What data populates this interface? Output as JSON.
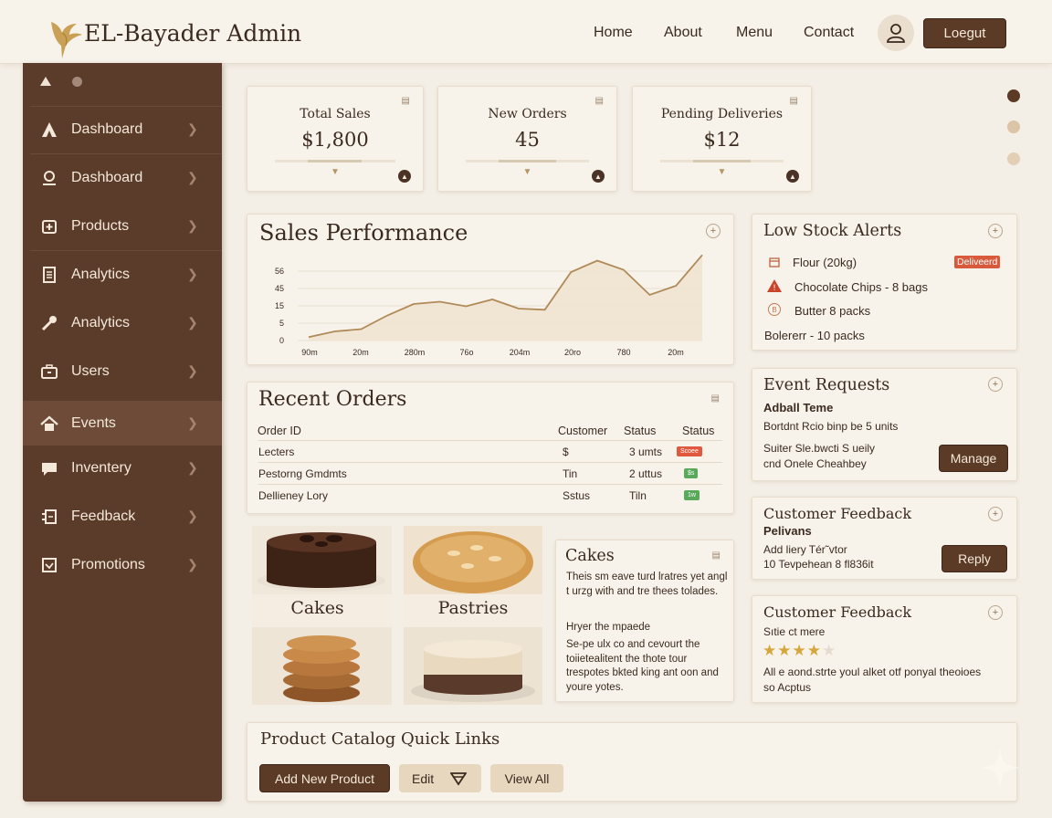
{
  "header": {
    "brand": "EL-Bayader Admin",
    "nav": [
      "Home",
      "About",
      "Menu",
      "Contact"
    ],
    "logout": "Loegut"
  },
  "sidebar": {
    "items": [
      {
        "label": "Dashboard",
        "icon": "user-a-icon"
      },
      {
        "label": "Dashboard",
        "icon": "user-outline-icon"
      },
      {
        "label": "Products",
        "icon": "box-plus-icon"
      },
      {
        "label": "Analytics",
        "icon": "document-icon"
      },
      {
        "label": "Analytics",
        "icon": "tools-icon"
      },
      {
        "label": "Users",
        "icon": "briefcase-icon"
      },
      {
        "label": "Events",
        "icon": "home-icon",
        "active": true
      },
      {
        "label": "Inventery",
        "icon": "chat-icon"
      },
      {
        "label": "Feedback",
        "icon": "feedback-icon"
      },
      {
        "label": "Promotions",
        "icon": "checkbox-icon"
      }
    ]
  },
  "stats": [
    {
      "title": "Total Sales",
      "value": "$1,800",
      "fill": 0.25
    },
    {
      "title": "New Orders",
      "value": "45",
      "fill": 0.4
    },
    {
      "title": "Pending Deliveries",
      "value": "$12",
      "fill": 0.4
    }
  ],
  "sales_performance": {
    "title": "Sales Performance",
    "chart_data": {
      "type": "area",
      "y_ticks": [
        "56",
        "45",
        "15",
        "5",
        "0"
      ],
      "x_ticks": [
        "90m",
        "20m",
        "280m",
        "76o",
        "204m",
        "20ro",
        "780",
        "20m"
      ],
      "values": [
        3,
        8,
        10,
        22,
        32,
        34,
        30,
        36,
        28,
        27,
        60,
        70,
        62,
        40,
        48,
        75
      ]
    }
  },
  "low_stock": {
    "title": "Low Stock Alerts",
    "items": [
      {
        "text": "Flour (20kg)",
        "badge": "Deliveerd"
      },
      {
        "text": "Chocolate Chips - 8 bags"
      },
      {
        "text": "Butter 8 packs"
      },
      {
        "text": "Bolererr - 10 packs"
      }
    ]
  },
  "recent_orders": {
    "title": "Recent Orders",
    "columns": [
      "Order ID",
      "Customer",
      "Status",
      "Status"
    ],
    "rows": [
      {
        "id": "Lecters",
        "customer": "$",
        "status": "3 umts",
        "badge": "Scoee",
        "badge_color": "#e0583d"
      },
      {
        "id": "Pestorng Gmdmts",
        "customer": "Tin",
        "status": "2 uttus",
        "badge": "$s",
        "badge_color": "#58a95a"
      },
      {
        "id": "Dellieney Lory",
        "customer": "Sstus",
        "status": "Tiln",
        "badge": "1w",
        "badge_color": "#58a95a"
      }
    ]
  },
  "event_requests": {
    "title": "Event Requests",
    "subtitle": "Adball Teme",
    "line1": "Bortdnt Rcio binp be 5 units",
    "line2": "Suiter Sle.bwcti S ueily",
    "line3": "cnd Onele Cheahbey",
    "button": "Manage"
  },
  "feedback1": {
    "title": "Customer Feedback",
    "subtitle": "Pelivans",
    "line1": "Add liery Tér˜vtor",
    "line2": "10 Tevpehean 8 fl836it",
    "button": "Reply"
  },
  "feedback2": {
    "title": "Customer Feedback",
    "subtitle": "Sıtie ct mere",
    "stars": 4,
    "stars_total": 5,
    "line1": "All e aond.strte youl alket otf ponyal theoioes",
    "line2": "so Acptus"
  },
  "gallery": [
    {
      "label": "Cakes"
    },
    {
      "label": "Pastries"
    },
    {
      "label": ""
    },
    {
      "label": ""
    }
  ],
  "cakes_card": {
    "title": "Cakes",
    "para1": "Theis sm eave turd lratres yet angl t urzg with and tre thees tolades.",
    "para2": "Hryer the mpaede",
    "para3": "Se-pe ulx co and cevourt the toiietealitent the thote tour trespotes bkted king ant oon and youre yotes."
  },
  "catalog": {
    "title": "Product Catalog Quick Links",
    "add": "Add New Product",
    "edit": "Edit",
    "view": "View All"
  },
  "colors": {
    "sidebar": "#5b3b2a",
    "accent": "#5b3a26",
    "badge_red": "#e0583d",
    "badge_green": "#58a95a"
  }
}
